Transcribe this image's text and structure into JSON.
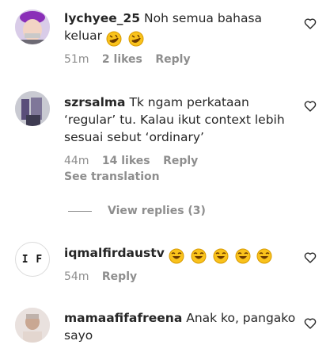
{
  "comments": [
    {
      "username": "lychyee_25",
      "text": "Noh semua bahasa keluar",
      "emojis": [
        "rofl-emoji",
        "rofl-emoji"
      ],
      "time": "51m",
      "likes": "2 likes",
      "reply": "Reply"
    },
    {
      "username": "szrsalma",
      "text": "Tk ngam perkataan ‘regular’ tu. Kalau ikut context lebih sesuai sebut ‘ordinary’",
      "time": "44m",
      "likes": "14 likes",
      "reply": "Reply",
      "see_translation": "See translation",
      "view_replies": "View replies (3)"
    },
    {
      "username": "iqmalfirdaustv",
      "avatar_text": "I F",
      "emojis": [
        "laughing-emoji",
        "laughing-emoji",
        "laughing-emoji",
        "laughing-emoji",
        "laughing-emoji"
      ],
      "time": "54m",
      "reply": "Reply"
    },
    {
      "username": "mamaafifafreena",
      "text": "Anak ko, pangako sayo"
    }
  ]
}
